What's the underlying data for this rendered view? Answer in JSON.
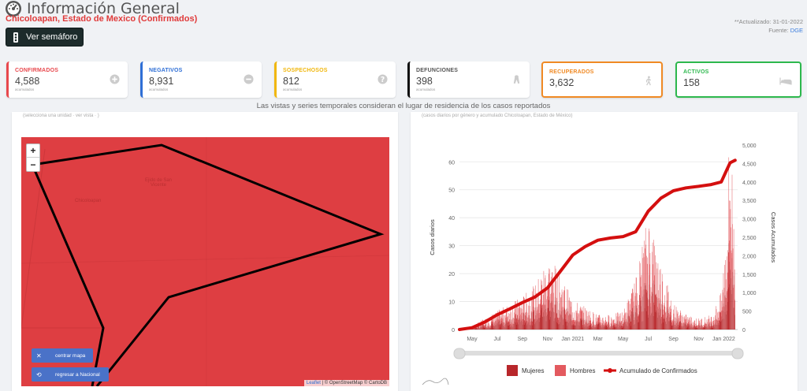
{
  "header": {
    "title": "Información General",
    "subtitle": "Chicoloapan, Estado de Mexico (Confirmados)",
    "updated": "**Actualizado: 31-01-2022",
    "source_label": "Fuente: ",
    "source_link": "DGE",
    "semaforo_button": "Ver semáforo"
  },
  "cards": [
    {
      "label": "CONFIRMADOS",
      "value": "4,588",
      "sub": "acumulados",
      "icon": "plus-circle-icon",
      "color": "#e8484d"
    },
    {
      "label": "NEGATIVOS",
      "value": "8,931",
      "sub": "acumulados",
      "icon": "minus-circle-icon",
      "color": "#2f6fd6"
    },
    {
      "label": "SOSPECHOSOS",
      "value": "812",
      "sub": "acumulados",
      "icon": "question-circle-icon",
      "color": "#f1b70d"
    },
    {
      "label": "DEFUNCIONES",
      "value": "398",
      "sub": "acumulados",
      "icon": "ribbon-icon",
      "color": "#111111"
    },
    {
      "label": "RECUPERADOS",
      "value": "3,632",
      "sub": "",
      "icon": "walking-icon",
      "color": "#f08a24"
    },
    {
      "label": "ACTIVOS",
      "value": "158",
      "sub": "",
      "icon": "bed-icon",
      "color": "#2db84d"
    }
  ],
  "notice": "Las vistas y series temporales consideran el lugar de residencia de los casos reportados",
  "map": {
    "hint": "(selecciona una unidad · ver vista · )",
    "zoom_in": "+",
    "zoom_out": "−",
    "center_button": "centrar mapa",
    "national_button": "regresar a Nacional",
    "attribution_leaflet": "Leaflet",
    "attribution_rest": " | © OpenStreetMap © CartoDB",
    "places": [
      "Chicoloapan",
      "Ejido de San Vicente"
    ],
    "fill_color": "#de3e42"
  },
  "chart": {
    "hint": "(casos diarios por género y acumulado Chicoloapan, Estado de México)",
    "ylabel_left": "Casos diarios",
    "ylabel_right": "Casos Acumulados",
    "legend": [
      "Mujeres",
      "Hombres",
      "Acumulado de Confirmados"
    ],
    "colors": {
      "mujeres": "#b8272b",
      "hombres": "#e35a5f",
      "acumulado": "#d40f0f"
    }
  },
  "chart_data": {
    "type": "bar",
    "x_tick_labels": [
      "May",
      "Jul",
      "Sep",
      "Nov",
      "Jan 2021",
      "Mar",
      "May",
      "Jul",
      "Sep",
      "Nov",
      "Jan 2022"
    ],
    "y_left_ticks": [
      0,
      10,
      20,
      30,
      40,
      50,
      60
    ],
    "y_right_ticks": [
      "0",
      "500",
      "1,000",
      "1,500",
      "2,000",
      "2,500",
      "3,000",
      "3,500",
      "4,000",
      "4,500",
      "5,000"
    ],
    "ylim_left": [
      0,
      66
    ],
    "ylim_right": [
      0,
      5000
    ],
    "xlim_months": [
      0,
      22.1
    ],
    "series": [
      {
        "name": "Mujeres",
        "kind": "bar",
        "note": "stacked daily cases"
      },
      {
        "name": "Hombres",
        "kind": "bar",
        "note": "stacked daily cases"
      },
      {
        "name": "Acumulado de Confirmados",
        "kind": "line",
        "axis": "right",
        "points": [
          [
            0,
            0
          ],
          [
            1,
            50
          ],
          [
            2,
            200
          ],
          [
            3,
            400
          ],
          [
            4,
            560
          ],
          [
            5,
            730
          ],
          [
            6,
            880
          ],
          [
            7,
            1130
          ],
          [
            8,
            1570
          ],
          [
            9,
            2020
          ],
          [
            10,
            2250
          ],
          [
            11,
            2420
          ],
          [
            12,
            2480
          ],
          [
            13,
            2520
          ],
          [
            14,
            2650
          ],
          [
            15,
            3210
          ],
          [
            16,
            3560
          ],
          [
            17,
            3760
          ],
          [
            18,
            3840
          ],
          [
            19,
            3880
          ],
          [
            20,
            3930
          ],
          [
            20.8,
            4000
          ],
          [
            21.2,
            4300
          ],
          [
            21.5,
            4520
          ],
          [
            21.9,
            4588
          ]
        ]
      }
    ],
    "daily_envelope": [
      [
        0,
        0
      ],
      [
        1,
        1
      ],
      [
        2,
        3
      ],
      [
        3,
        5
      ],
      [
        4,
        7
      ],
      [
        5,
        9
      ],
      [
        6,
        12
      ],
      [
        7,
        20
      ],
      [
        8,
        15
      ],
      [
        9,
        8
      ],
      [
        10,
        6
      ],
      [
        11,
        4
      ],
      [
        12,
        4
      ],
      [
        13,
        5
      ],
      [
        14,
        14
      ],
      [
        15,
        32
      ],
      [
        16,
        18
      ],
      [
        17,
        7
      ],
      [
        18,
        4
      ],
      [
        19,
        3
      ],
      [
        20,
        4
      ],
      [
        20.8,
        10
      ],
      [
        21.2,
        30
      ],
      [
        21.5,
        60
      ],
      [
        21.9,
        20
      ]
    ]
  }
}
